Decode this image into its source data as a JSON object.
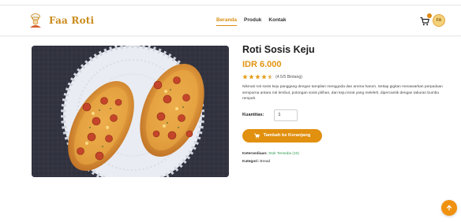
{
  "brand": {
    "name": "Faa Roti",
    "logo_icon": "chef-logo-icon"
  },
  "nav": {
    "links": [
      {
        "label": "Beranda",
        "active": true
      },
      {
        "label": "Produk",
        "active": false
      },
      {
        "label": "Kontak",
        "active": false
      }
    ],
    "cart_icon": "cart-icon",
    "avatar_initials": "FA"
  },
  "product": {
    "title": "Roti Sosis Keju",
    "price": "IDR 6.000",
    "rating_value": 4.5,
    "rating_text": "(4.5/5 Bintang)",
    "description": "Nikmati roti sosis keju panggang dengan tampilan menggoda dan aroma harum. Setiap gigitan menawarkan perpaduan sempurna antara roti lembut, potongan sosis pilihan, dan keju lezat yang meleleh, dipercantik dengan taburan bumbu rempah.",
    "quantity_label": "Kuantitas:",
    "quantity_value": "1",
    "add_button_label": "Tambah ke Keranjang",
    "availability_label": "Ketersediaan:",
    "availability_value": "Stok Tersedia (10)",
    "category_label": "Kategori:",
    "category_value": "Bread"
  },
  "colors": {
    "accent": "#e1900f",
    "stock": "#2c9a4e"
  },
  "scroll_top_icon": "arrow-up-icon"
}
